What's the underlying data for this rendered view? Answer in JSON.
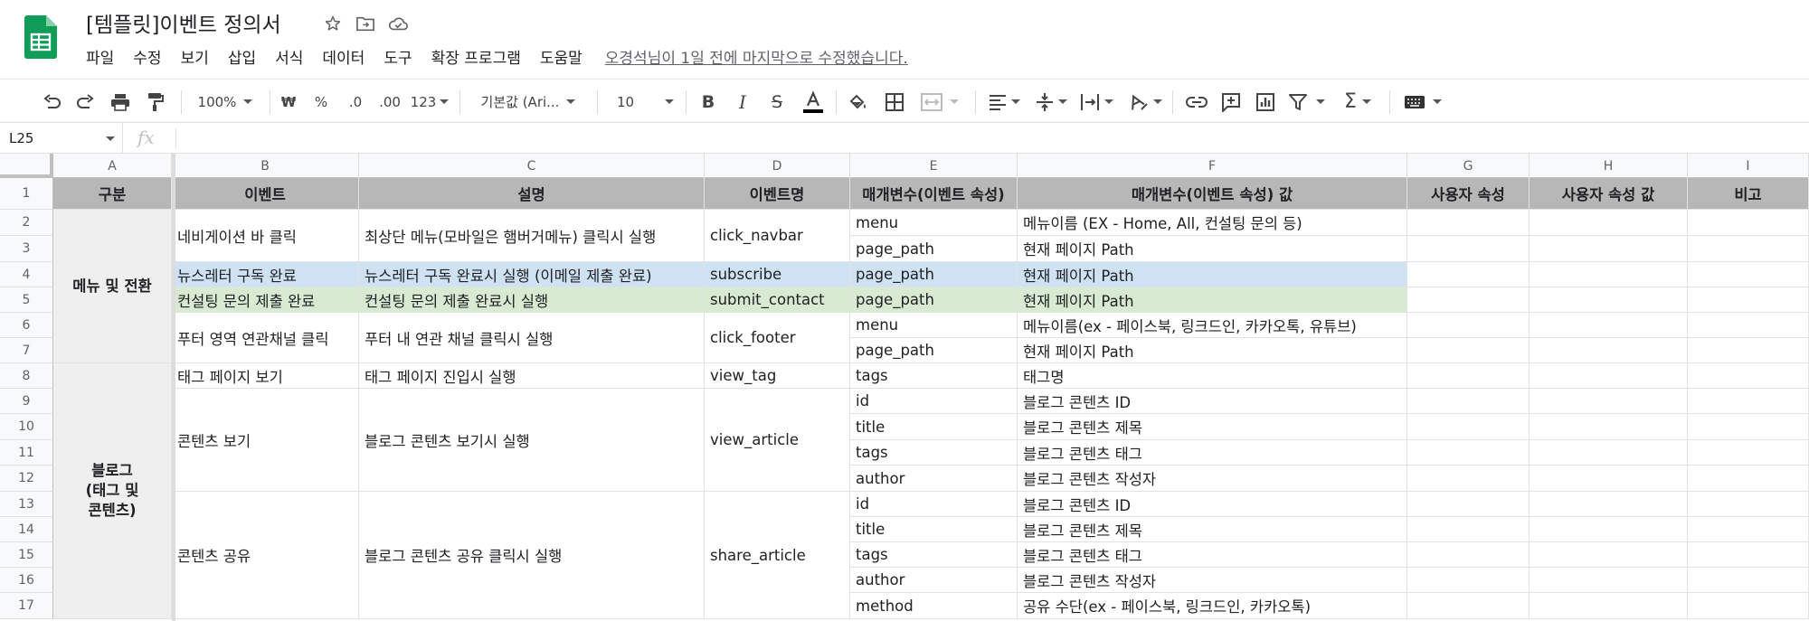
{
  "app": {
    "title": "[템플릿]이벤트 정의서",
    "logo_icon": "google-sheets-icon",
    "brand_color": "#0f9d58"
  },
  "menu": {
    "items": [
      "파일",
      "수정",
      "보기",
      "삽입",
      "서식",
      "데이터",
      "도구",
      "확장 프로그램",
      "도움말"
    ],
    "last_edit": "오경석님이 1일 전에 마지막으로 수정했습니다."
  },
  "toolbar": {
    "zoom": "100%",
    "currency": "₩",
    "percent": "%",
    "dec_less": ".0",
    "dec_more": ".00",
    "number_format": "123",
    "font": "기본값 (Ari...",
    "font_size": "10"
  },
  "formula": {
    "cell_ref": "L25",
    "fx": "fx",
    "value": ""
  },
  "grid": {
    "columns": [
      "A",
      "B",
      "C",
      "D",
      "E",
      "F",
      "G",
      "H",
      "I"
    ],
    "row_numbers": [
      "1",
      "2",
      "3",
      "4",
      "5",
      "6",
      "7",
      "8",
      "9",
      "10",
      "11",
      "12",
      "13",
      "14",
      "15",
      "16",
      "17"
    ],
    "headers": [
      "구분",
      "이벤트",
      "설명",
      "이벤트명",
      "매개변수(이벤트 속성)",
      "매개변수(이벤트 속성) 값",
      "사용자 속성",
      "사용자 속성 값",
      "비고"
    ],
    "categories": [
      {
        "label": "메뉴 및 전환"
      },
      {
        "label": "블로그\n(태그 및\n콘텐츠)"
      }
    ],
    "events": [
      {
        "event": "네비게이션 바 클릭",
        "desc": "최상단 메뉴(모바일은 햄버거메뉴) 클릭시 실행",
        "name": "click_navbar",
        "params": [
          {
            "key": "menu",
            "value": "메뉴이름 (EX - Home, All, 컨설팅 문의 등)"
          },
          {
            "key": "page_path",
            "value": "현재 페이지 Path"
          }
        ]
      },
      {
        "event": "뉴스레터 구독 완료",
        "desc": "뉴스레터 구독 완료시 실행 (이메일 제출 완료)",
        "name": "subscribe",
        "params": [
          {
            "key": "page_path",
            "value": "현재 페이지 Path"
          }
        ]
      },
      {
        "event": "컨설팅 문의 제출 완료",
        "desc": "컨설팅 문의 제출 완료시 실행",
        "name": "submit_contact",
        "params": [
          {
            "key": "page_path",
            "value": "현재 페이지 Path"
          }
        ]
      },
      {
        "event": "푸터 영역 연관채널 클릭",
        "desc": "푸터 내 연관 채널 클릭시 실행",
        "name": "click_footer",
        "params": [
          {
            "key": "menu",
            "value": "메뉴이름(ex - 페이스북, 링크드인, 카카오톡, 유튜브)"
          },
          {
            "key": "page_path",
            "value": "현재 페이지 Path"
          }
        ]
      },
      {
        "event": "태그 페이지 보기",
        "desc": "태그 페이지 진입시 실행",
        "name": "view_tag",
        "params": [
          {
            "key": "tags",
            "value": "태그명"
          }
        ]
      },
      {
        "event": "콘텐츠 보기",
        "desc": "블로그 콘텐츠 보기시 실행",
        "name": "view_article",
        "params": [
          {
            "key": "id",
            "value": "블로그 콘텐츠 ID"
          },
          {
            "key": "title",
            "value": "블로그 콘텐츠 제목"
          },
          {
            "key": "tags",
            "value": "블로그 콘텐츠 태그"
          },
          {
            "key": "author",
            "value": "블로그 콘텐츠 작성자"
          }
        ]
      },
      {
        "event": "콘텐츠 공유",
        "desc": "블로그 콘텐츠 공유 클릭시 실행",
        "name": "share_article",
        "params": [
          {
            "key": "id",
            "value": "블로그 콘텐츠 ID"
          },
          {
            "key": "title",
            "value": "블로그 콘텐츠 제목"
          },
          {
            "key": "tags",
            "value": "블로그 콘텐츠 태그"
          },
          {
            "key": "author",
            "value": "블로그 콘텐츠 작성자"
          },
          {
            "key": "method",
            "value": "공유 수단(ex - 페이스북, 링크드인, 카카오톡)"
          }
        ]
      }
    ],
    "colors": {
      "header_bg": "#b7b7b7",
      "category_bg": "#efefef",
      "row_blue": "#cfe2f3",
      "row_green": "#d9ead3"
    }
  }
}
